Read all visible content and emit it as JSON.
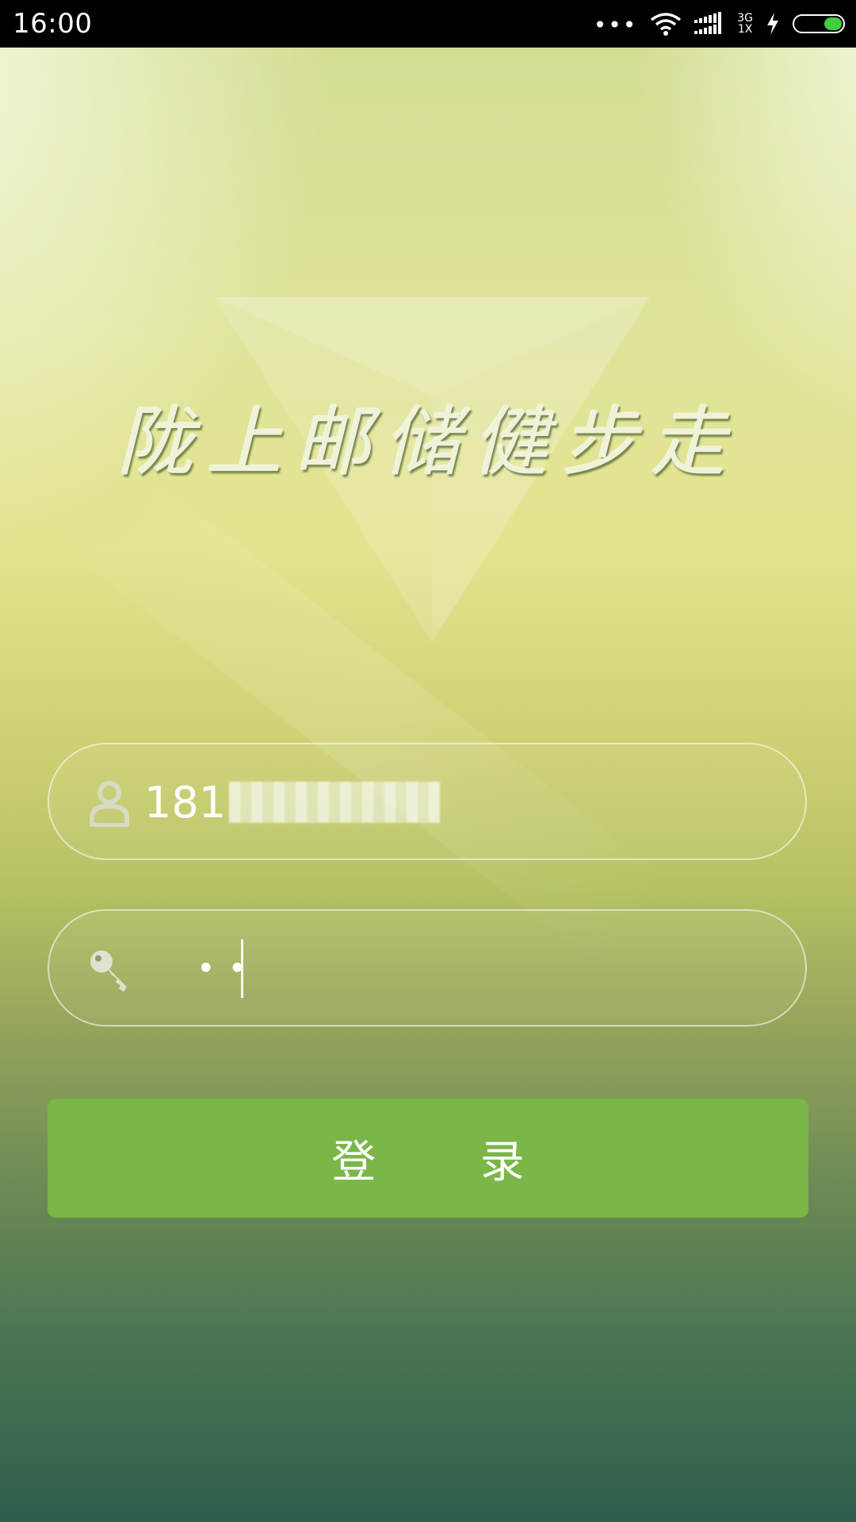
{
  "status_bar": {
    "time": "16:00",
    "dots": "•••",
    "network_top": "3G",
    "network_bottom": "1X"
  },
  "app": {
    "title": "陇上邮储健步走"
  },
  "login": {
    "username_value": "181",
    "password_value": "••",
    "submit_label": "登 录"
  },
  "colors": {
    "button": "#7ab648",
    "battery": "#3fcf3f"
  },
  "icons": {
    "user": "user-icon",
    "password": "key-icon"
  }
}
